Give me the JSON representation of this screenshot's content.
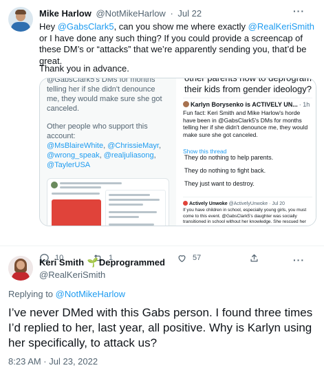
{
  "tweet1": {
    "name": "Mike Harlow",
    "handle": "@NotMikeHarlow",
    "separator": "·",
    "date": "Jul 22",
    "more": "···",
    "body_part1": "Hey ",
    "mention1": "@GabsClark5",
    "body_part2": ", can you show me where exactly ",
    "mention2": "@RealKeriSmith",
    "body_part3": " or I have done any such thing? If you could provide a screencap of these DM’s or “attacks” that we’re apparently sending you, that’d be great.",
    "sign_off": "Thank you in advance.",
    "media": {
      "left_line1": "@GabsClark5's DMs for months",
      "left_line2": "telling her if she didn't denounce",
      "left_line3": "me, they would make sure she got",
      "left_line4": "canceled.",
      "left_support": "Other people who support this account:",
      "left_m1": "@MsBlaireWhite",
      "left_m2": "@ChrissieMayr",
      "left_m3": "@wrong_speak",
      "left_m4": "@realjuliasong",
      "left_m5": "@TaylerUSA",
      "right_top": "other parents how to deprogram their kids from gender ideology?",
      "quote_name": "Karlyn Borysenko is ACTIVELY UN...",
      "quote_time": "· 1h",
      "quote_body": "Fun fact: Keri Smith and Mike Harlow's horde have been in @GabsClark5's DMs for months telling her if she didn't denounce me, they would make sure she got canceled.",
      "show_thread": "Show this thread",
      "line1": "They do nothing to help parents.",
      "line2": "They do nothing to fight back.",
      "line3": "They just want to destroy.",
      "card2_name": "Actively Unwoke",
      "card2_meta": "@ActivelyUnwoke · Jul 20",
      "card2_body": "If you have children in school, especially young girls, you must come to this event. @GabsClark5's daughter was socially transitioned in school without her knowledge. She rescued her daughter, and successfully deprogrammed her. Learn how she did it: activelyunwoke.com/events/"
    },
    "actions": {
      "replies": "10",
      "retweets": "1",
      "likes": "57"
    }
  },
  "tweet2": {
    "name": "Keri Smith",
    "name_emoji": "🌱",
    "name_suffix": "Deprogrammed",
    "handle": "@RealKeriSmith",
    "more": "···",
    "replying_prefix": "Replying to ",
    "replying_to": "@NotMikeHarlow",
    "body": "I’ve never DMed with this Gabs person. I found three times I’d replied to her, last year, all positive. Why is Karlyn using her specifically, to attack us?",
    "timestamp": "8:23 AM · Jul 23, 2022"
  },
  "colors": {
    "accent": "#1d9bf0",
    "text": "#0f1419",
    "secondary": "#536471",
    "border": "#cfd9de"
  }
}
